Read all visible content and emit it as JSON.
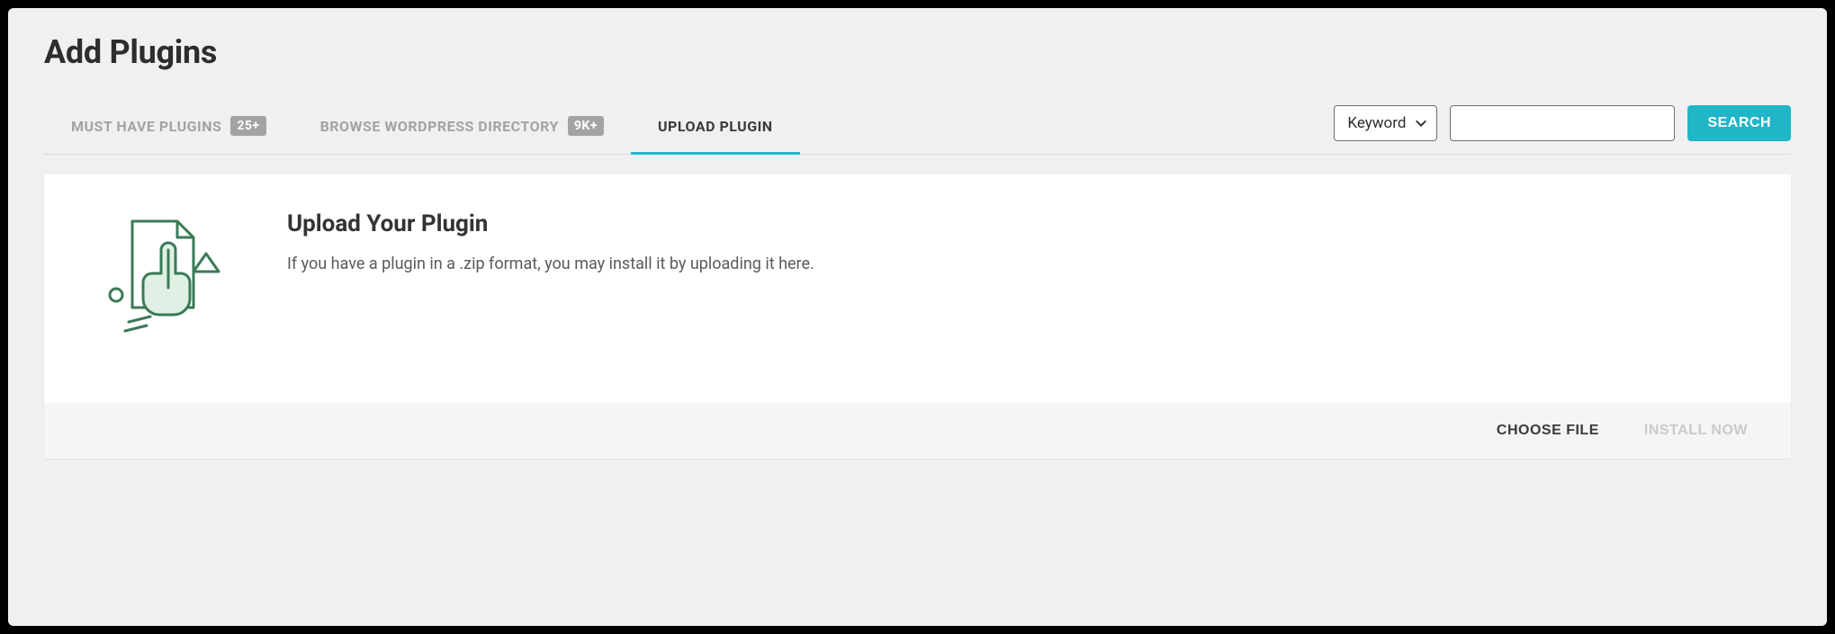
{
  "page": {
    "title": "Add Plugins"
  },
  "tabs": {
    "must_have": {
      "label": "MUST HAVE PLUGINS",
      "badge": "25+"
    },
    "browse": {
      "label": "BROWSE WORDPRESS DIRECTORY",
      "badge": "9K+"
    },
    "upload": {
      "label": "UPLOAD PLUGIN"
    }
  },
  "search": {
    "filter_selected": "Keyword",
    "input_value": "",
    "button": "SEARCH"
  },
  "panel": {
    "heading": "Upload Your Plugin",
    "description": "If you have a plugin in a .zip format, you may install it by uploading it here."
  },
  "footer": {
    "choose_file": "CHOOSE FILE",
    "install_now": "INSTALL NOW"
  }
}
